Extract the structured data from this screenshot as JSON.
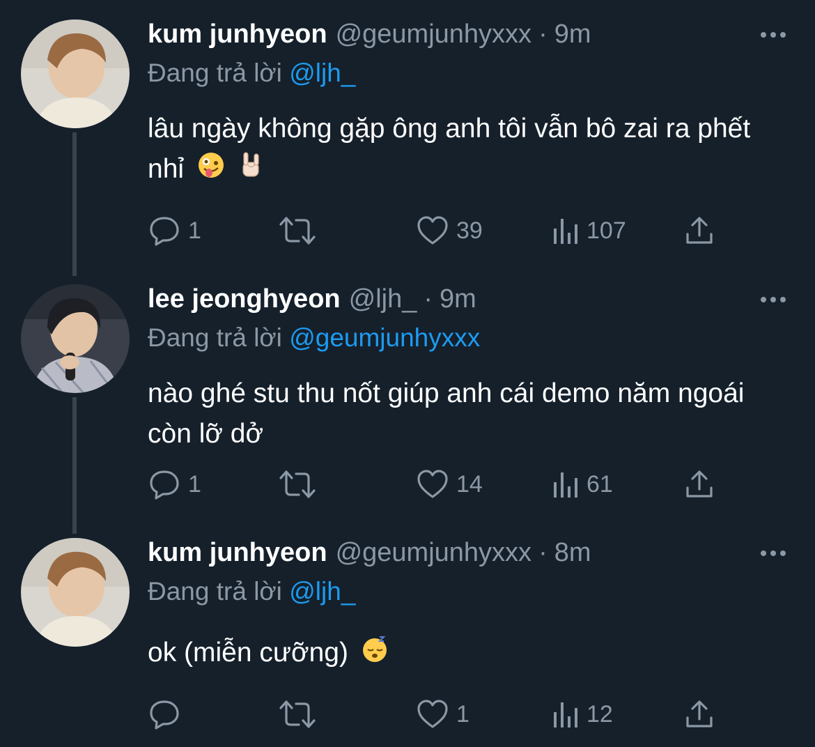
{
  "tweets": [
    {
      "name": "kum junhyeon",
      "handle": "@geumjunhyxxx",
      "separator": "·",
      "time": "9m",
      "replying_prefix": "Đang trả lời",
      "replying_to": "@ljh_",
      "text": "lâu ngày không gặp ông anh tôi vẫn bô zai ra phết nhỉ",
      "emojis": [
        "zany-face-emoji",
        "rock-on-hand-emoji"
      ],
      "stats": {
        "replies": "1",
        "retweets": "",
        "likes": "39",
        "views": "107"
      }
    },
    {
      "name": "lee jeonghyeon",
      "handle": "@ljh_",
      "separator": "·",
      "time": "9m",
      "replying_prefix": "Đang trả lời",
      "replying_to": "@geumjunhyxxx",
      "text": "nào ghé stu thu nốt giúp anh cái demo năm ngoái còn lỡ dở",
      "emojis": [],
      "stats": {
        "replies": "1",
        "retweets": "",
        "likes": "14",
        "views": "61"
      }
    },
    {
      "name": "kum junhyeon",
      "handle": "@geumjunhyxxx",
      "separator": "·",
      "time": "8m",
      "replying_prefix": "Đang trả lời",
      "replying_to": "@ljh_",
      "text": "ok (miễn cưỡng)",
      "emojis": [
        "sleeping-face-emoji"
      ],
      "stats": {
        "replies": "",
        "retweets": "",
        "likes": "1",
        "views": "12"
      }
    }
  ],
  "icons": {
    "reply": "reply-icon",
    "retweet": "retweet-icon",
    "like": "heart-icon",
    "views": "views-icon",
    "share": "share-icon",
    "more": "more-icon"
  },
  "colors": {
    "background": "#15202b",
    "text": "#ffffff",
    "muted": "#8b98a5",
    "accent": "#1d9bf0",
    "thread_line": "#38444d"
  }
}
